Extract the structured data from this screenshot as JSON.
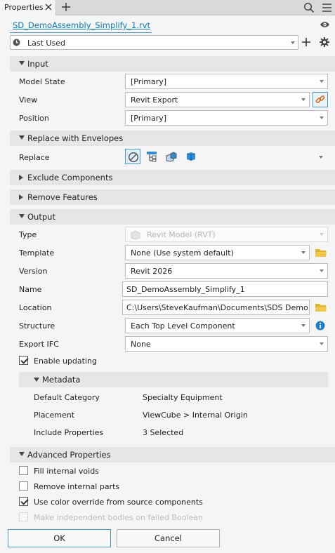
{
  "tab": {
    "title": "Properties"
  },
  "file_link": "SD_DemoAssembly_Simplify_1.rvt",
  "preset": {
    "value": "Last Used"
  },
  "sections": {
    "input": "Input",
    "replace": "Replace with Envelopes",
    "exclude": "Exclude Components",
    "remove": "Remove Features",
    "output": "Output",
    "advanced": "Advanced Properties"
  },
  "input": {
    "model_state": {
      "label": "Model State",
      "value": "[Primary]"
    },
    "view": {
      "label": "View",
      "value": "Revit Export"
    },
    "position": {
      "label": "Position",
      "value": "[Primary]"
    }
  },
  "replace": {
    "label": "Replace",
    "icons": [
      "none-icon",
      "bounding-hierarchy-icon",
      "parts-box-icon",
      "single-box-icon"
    ]
  },
  "output": {
    "type": {
      "label": "Type",
      "value": "Revit Model (RVT)"
    },
    "template": {
      "label": "Template",
      "value": "None (Use system default)"
    },
    "version": {
      "label": "Version",
      "value": "Revit 2026"
    },
    "name": {
      "label": "Name",
      "value": "SD_DemoAssembly_Simplify_1"
    },
    "location": {
      "label": "Location",
      "value": "C:\\Users\\SteveKaufman\\Documents\\SDS DemoSet PF"
    },
    "structure": {
      "label": "Structure",
      "value": "Each Top Level Component"
    },
    "export_ifc": {
      "label": "Export IFC",
      "value": "None"
    },
    "enable_updating": {
      "label": "Enable updating",
      "checked": true
    }
  },
  "metadata": {
    "title": "Metadata",
    "rows": [
      {
        "key": "Default Category",
        "value": "Specialty Equipment"
      },
      {
        "key": "Placement",
        "value": "ViewCube > Internal Origin"
      },
      {
        "key": "Include Properties",
        "value": "3 Selected"
      }
    ]
  },
  "advanced": {
    "fill_voids": {
      "label": "Fill internal voids",
      "checked": false
    },
    "remove_parts": {
      "label": "Remove internal parts",
      "checked": false
    },
    "color_override": {
      "label": "Use color override from source components",
      "checked": true
    },
    "independent_bodies": {
      "label": "Make independent bodies on failed Boolean",
      "checked": false,
      "disabled": true
    }
  },
  "buttons": {
    "ok": "OK",
    "cancel": "Cancel"
  },
  "colors": {
    "accent": "#3f9ad6",
    "link": "#0a7ab8",
    "folder": "#e8b520",
    "info": "#1f7fc6"
  }
}
